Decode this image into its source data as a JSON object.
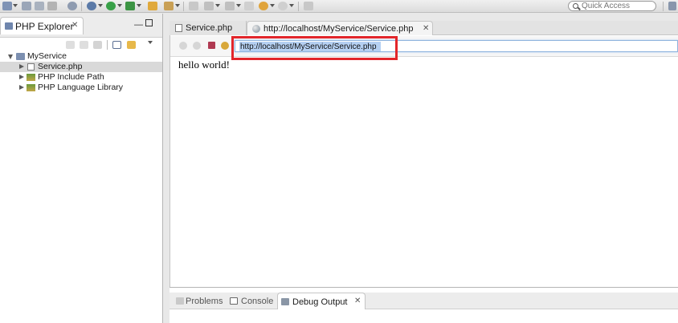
{
  "toolbar": {
    "quick_access_placeholder": "Quick Access",
    "icons": [
      "new-icon",
      "save-icon",
      "print-icon",
      "debug-icon",
      "run-icon",
      "external-tools-icon",
      "open-folder-icon",
      "search-icon",
      "back-icon",
      "forward-icon"
    ]
  },
  "explorer": {
    "title": "PHP Explorer",
    "tree": [
      {
        "label": "MyService",
        "level": 0,
        "expanded": true,
        "icon": "project-icon"
      },
      {
        "label": "Service.php",
        "level": 1,
        "expanded": false,
        "selected": true,
        "icon": "php-file-icon"
      },
      {
        "label": "PHP Include Path",
        "level": 1,
        "expanded": false,
        "icon": "library-icon"
      },
      {
        "label": "PHP Language Library",
        "level": 1,
        "expanded": false,
        "icon": "library-icon"
      }
    ]
  },
  "editor": {
    "tabs": [
      {
        "label": "Service.php",
        "active": false
      },
      {
        "label": "http://localhost/MyService/Service.php",
        "active": true
      }
    ],
    "url": "http://localhost/MyService/Service.php",
    "content": "hello world!"
  },
  "bottom": {
    "tabs": [
      {
        "label": "Problems",
        "active": false
      },
      {
        "label": "Console",
        "active": false
      },
      {
        "label": "Debug Output",
        "active": true
      }
    ]
  },
  "colors": {
    "highlight_box": "#e2262b",
    "selection": "#b5d0f2",
    "tree_selected": "#d9d9d9"
  }
}
